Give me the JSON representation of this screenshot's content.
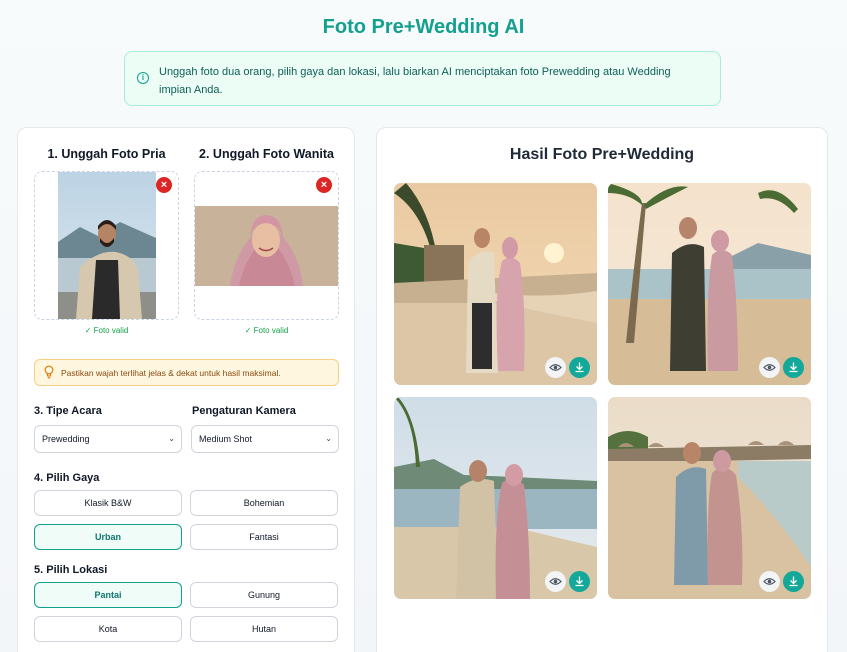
{
  "app": {
    "title": "Foto Pre+Wedding AI"
  },
  "info": {
    "text": "Unggah foto dua orang, pilih gaya dan lokasi, lalu biarkan AI menciptakan foto Prewedding atau Wedding impian Anda."
  },
  "upload": {
    "male": {
      "title": "1. Unggah Foto Pria",
      "status": "✓ Foto valid"
    },
    "female": {
      "title": "2. Unggah Foto Wanita",
      "status": "✓ Foto valid"
    },
    "remove_symbol": "×"
  },
  "tip": {
    "text": "Pastikan wajah terlihat jelas & dekat untuk hasil maksimal."
  },
  "event": {
    "label": "3. Tipe Acara",
    "value": "Prewedding"
  },
  "camera": {
    "label": "Pengaturan Kamera",
    "value": "Medium Shot"
  },
  "style": {
    "label": "4. Pilih Gaya",
    "options": [
      "Klasik B&W",
      "Bohemian",
      "Urban",
      "Fantasi"
    ],
    "selected": "Urban"
  },
  "location": {
    "label": "5. Pilih Lokasi",
    "options": [
      "Pantai",
      "Gunung",
      "Kota",
      "Hutan"
    ],
    "selected": "Pantai"
  },
  "results": {
    "title": "Hasil Foto Pre+Wedding",
    "photos": [
      {
        "scene": "beach-sunset-couple"
      },
      {
        "scene": "beach-palm-couple"
      },
      {
        "scene": "beach-embrace-couple"
      },
      {
        "scene": "beach-umbrella-couple"
      }
    ]
  },
  "colors": {
    "accent": "#14a08f",
    "remove": "#dc2626",
    "valid": "#16a34a",
    "warning_bg": "#fef6df"
  },
  "icons": {
    "info": "info-icon",
    "lightbulb": "lightbulb-icon",
    "remove": "close-icon",
    "view": "eye-icon",
    "download": "download-icon",
    "select": "chevron-down-icon"
  }
}
